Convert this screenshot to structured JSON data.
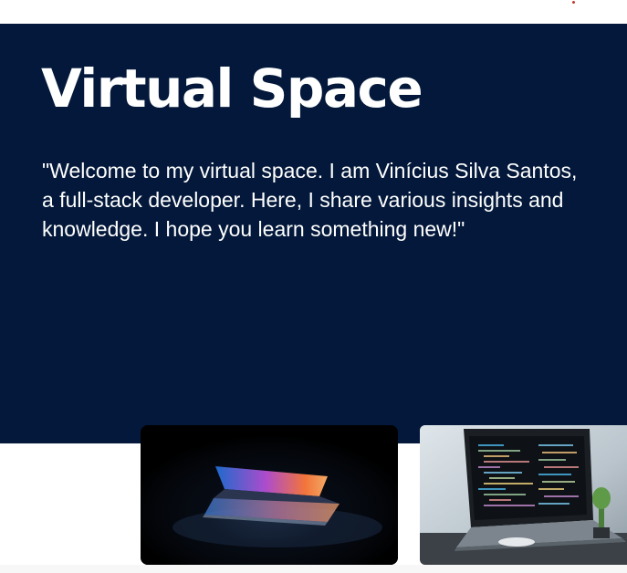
{
  "colors": {
    "hero_background": "#03183a",
    "page_background": "#ffffff",
    "hero_text": "#ffffff",
    "top_dot": "#c0392b"
  },
  "top_indicator": {
    "icon": "dot-icon"
  },
  "hero": {
    "title": "Virtual Space",
    "description": "\"Welcome to my virtual space. I am Vinícius Silva Santos, a full-stack developer. Here, I share various insights and knowledge. I hope you learn something new!\""
  },
  "cards": [
    {
      "image": "laptop-dark-glow-image"
    },
    {
      "image": "laptop-code-image"
    }
  ]
}
